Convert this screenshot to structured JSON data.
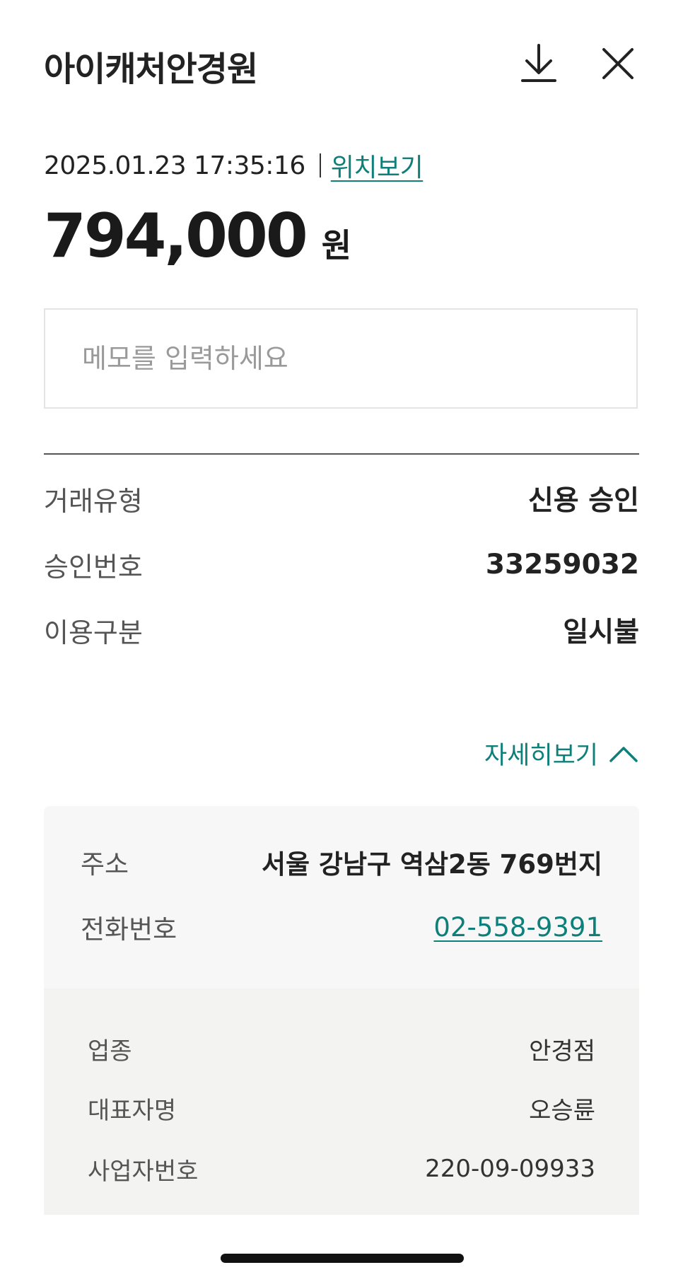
{
  "header": {
    "merchant_name": "아이캐처안경원",
    "download_icon": "download-icon",
    "close_icon": "close-icon"
  },
  "transaction": {
    "datetime": "2025.01.23 17:35:16",
    "location_link": "위치보기",
    "amount": "794,000",
    "currency_unit": "원"
  },
  "memo": {
    "placeholder": "메모를 입력하세요",
    "value": ""
  },
  "summary": {
    "rows": [
      {
        "label": "거래유형",
        "value": "신용 승인"
      },
      {
        "label": "승인번호",
        "value": "33259032"
      },
      {
        "label": "이용구분",
        "value": "일시불"
      }
    ]
  },
  "detail_toggle": {
    "label": "자세히보기",
    "icon": "chevron-up-icon",
    "expanded": true
  },
  "store_info": {
    "address_label": "주소",
    "address_value": "서울 강남구 역삼2동 769번지",
    "phone_label": "전화번호",
    "phone_value": "02-558-9391"
  },
  "business_info": {
    "rows": [
      {
        "label": "업종",
        "value": "안경점"
      },
      {
        "label": "대표자명",
        "value": "오승륜"
      },
      {
        "label": "사업자번호",
        "value": "220-09-09933"
      }
    ]
  },
  "colors": {
    "accent": "#0f7f7a",
    "text_primary": "#222222",
    "text_secondary": "#555555",
    "panel_bg": "#f7f7f7",
    "biz_panel_bg": "#f3f3f2"
  }
}
